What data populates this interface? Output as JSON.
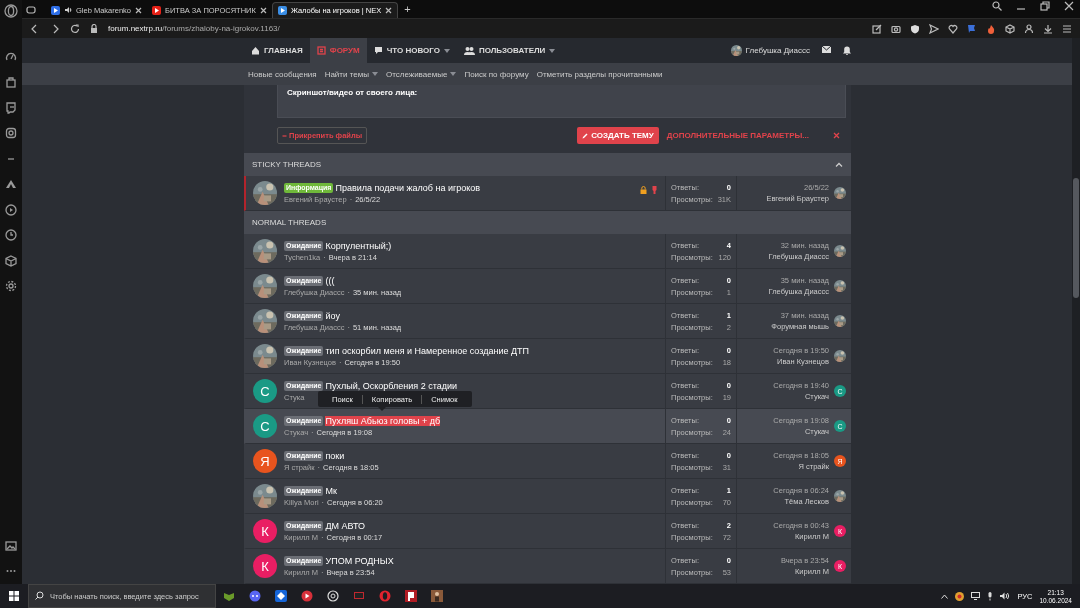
{
  "browser": {
    "tabs": [
      {
        "title": "Gleb Makarenko",
        "selected": false,
        "audio": true
      },
      {
        "title": "БИТВА ЗА ПОРОСЯТНИК",
        "selected": false,
        "audio": false
      },
      {
        "title": "Жалобы на игроков | NEX",
        "selected": true,
        "audio": false
      }
    ],
    "new_tab": "+",
    "url_host": "forum.nextrp.ru",
    "url_path": "/forums/zhaloby-na-igrokov.1163/"
  },
  "forum": {
    "nav": [
      {
        "label": "ГЛАВНАЯ",
        "selected": false,
        "dropdown": false
      },
      {
        "label": "ФОРУМ",
        "selected": true,
        "dropdown": false
      },
      {
        "label": "ЧТО НОВОГО",
        "selected": false,
        "dropdown": true
      },
      {
        "label": "ПОЛЬЗОВАТЕЛИ",
        "selected": false,
        "dropdown": true
      }
    ],
    "user": "Глебушка Диассс",
    "subnav": [
      {
        "label": "Новые сообщения",
        "dropdown": false
      },
      {
        "label": "Найти темы",
        "dropdown": true
      },
      {
        "label": "Отслеживаемые",
        "dropdown": true
      },
      {
        "label": "Поиск по форуму",
        "dropdown": false
      },
      {
        "label": "Отметить разделы прочитанными",
        "dropdown": false
      }
    ],
    "editor_line": "Скриншот/видео от своего лица:",
    "attach_button": "Прикрепить файлы",
    "create_button": "СОЗДАТЬ ТЕМУ",
    "more_options": "ДОПОЛНИТЕЛЬНЫЕ ПАРАМЕТРЫ...",
    "meta_separator": "·",
    "sections": [
      {
        "title": "STICKY THREADS",
        "collapsible": true,
        "threads": [
          {
            "prefix": {
              "text": "Информация",
              "color": "#6fb83a"
            },
            "title": "Правила подачи жалоб на игроков",
            "author": "Евгений Браустер",
            "date": "26/5/22",
            "replies_label": "Ответы:",
            "replies": "0",
            "views_label": "Просмотры:",
            "views": "31K",
            "last_date": "26/5/22",
            "last_user": "Евгений Браустер",
            "locked": true,
            "pinned": true,
            "marked": true,
            "selected": false,
            "title_selected": false
          }
        ]
      },
      {
        "title": "NORMAL THREADS",
        "collapsible": false,
        "threads": [
          {
            "prefix": {
              "text": "Ожидание",
              "color": "#6b6e75"
            },
            "title": "Корпулентный;)",
            "author": "Tychen1ka",
            "date": "Вчера в 21:14",
            "replies_label": "Ответы:",
            "replies": "4",
            "views_label": "Просмотры:",
            "views": "120",
            "last_date": "32 мин. назад",
            "last_user": "Глебушка Диассс",
            "locked": false,
            "pinned": false,
            "marked": false,
            "selected": false,
            "title_selected": false
          },
          {
            "prefix": {
              "text": "Ожидание",
              "color": "#6b6e75"
            },
            "title": "(((",
            "author": "Глебушка Диассс",
            "date": "35 мин. назад",
            "replies_label": "Ответы:",
            "replies": "0",
            "views_label": "Просмотры:",
            "views": "1",
            "last_date": "35 мин. назад",
            "last_user": "Глебушка Диассс",
            "locked": false,
            "pinned": false,
            "marked": false,
            "selected": false,
            "title_selected": false
          },
          {
            "prefix": {
              "text": "Ожидание",
              "color": "#6b6e75"
            },
            "title": "йоу",
            "author": "Глебушка Диассс",
            "date": "51 мин. назад",
            "replies_label": "Ответы:",
            "replies": "1",
            "views_label": "Просмотры:",
            "views": "2",
            "last_date": "37 мин. назад",
            "last_user": "Форумная мышь",
            "locked": false,
            "pinned": false,
            "marked": false,
            "selected": false,
            "title_selected": false
          },
          {
            "prefix": {
              "text": "Ожидание",
              "color": "#6b6e75"
            },
            "title": "тип оскорбил меня и Намеренное создание ДТП",
            "author": "Иван Кузнецов",
            "date": "Сегодня в 19:50",
            "replies_label": "Ответы:",
            "replies": "0",
            "views_label": "Просмотры:",
            "views": "18",
            "last_date": "Сегодня в 19:50",
            "last_user": "Иван Кузнецов",
            "locked": false,
            "pinned": false,
            "marked": false,
            "selected": false,
            "title_selected": false
          },
          {
            "prefix": {
              "text": "Ожидание",
              "color": "#6b6e75"
            },
            "title": "Пухлый, Оскорбления 2 стадии",
            "author": "Стука",
            "replies_label": "Ответы:",
            "replies": "0",
            "views_label": "Просмотры:",
            "views": "19",
            "last_date": "Сегодня в 19:40",
            "last_user": "Стукач",
            "avatar": {
              "kind": "letter",
              "letter": "С",
              "color": "#1a9a85"
            },
            "last_avatar": {
              "kind": "letter",
              "letter": "С",
              "color": "#1a9a85"
            },
            "locked": false,
            "pinned": false,
            "marked": false,
            "selected": false,
            "title_selected": false
          },
          {
            "prefix": {
              "text": "Ожидание",
              "color": "#6b6e75"
            },
            "title": "Пухляш Абьюз головы + дб",
            "author": "Стукач",
            "date": "Сегодня в 19:08",
            "replies_label": "Ответы:",
            "replies": "0",
            "views_label": "Просмотры:",
            "views": "24",
            "last_date": "Сегодня в 19:08",
            "last_user": "Стукач",
            "avatar": {
              "kind": "letter",
              "letter": "С",
              "color": "#1a9a85"
            },
            "last_avatar": {
              "kind": "letter",
              "letter": "С",
              "color": "#1a9a85"
            },
            "locked": false,
            "pinned": false,
            "marked": false,
            "selected": true,
            "title_selected": true
          },
          {
            "prefix": {
              "text": "Ожидание",
              "color": "#6b6e75"
            },
            "title": "поки",
            "author": "Я страйк",
            "date": "Сегодня в 18:05",
            "replies_label": "Ответы:",
            "replies": "0",
            "views_label": "Просмотры:",
            "views": "31",
            "last_date": "Сегодня в 18:05",
            "last_user": "Я страйк",
            "avatar": {
              "kind": "letter",
              "letter": "Я",
              "color": "#e8541e"
            },
            "last_avatar": {
              "kind": "letter",
              "letter": "Я",
              "color": "#e8541e"
            },
            "locked": false,
            "pinned": false,
            "marked": false,
            "selected": false,
            "title_selected": false
          },
          {
            "prefix": {
              "text": "Ожидание",
              "color": "#6b6e75"
            },
            "title": "Мк",
            "author": "Killya Mori",
            "date": "Сегодня в 06:20",
            "replies_label": "Ответы:",
            "replies": "1",
            "views_label": "Просмотры:",
            "views": "70",
            "last_date": "Сегодня в 06:24",
            "last_user": "Тёма Лесков",
            "locked": false,
            "pinned": false,
            "marked": false,
            "selected": false,
            "title_selected": false
          },
          {
            "prefix": {
              "text": "Ожидание",
              "color": "#6b6e75"
            },
            "title": "ДМ АВТО",
            "author": "Кирилл М",
            "date": "Сегодня в 00:17",
            "replies_label": "Ответы:",
            "replies": "2",
            "views_label": "Просмотры:",
            "views": "72",
            "last_date": "Сегодня в 00:43",
            "last_user": "Кирилл М",
            "avatar": {
              "kind": "letter",
              "letter": "К",
              "color": "#e91e63"
            },
            "last_avatar": {
              "kind": "letter",
              "letter": "К",
              "color": "#e91e63"
            },
            "locked": false,
            "pinned": false,
            "marked": false,
            "selected": false,
            "title_selected": false
          },
          {
            "prefix": {
              "text": "Ожидание",
              "color": "#6b6e75"
            },
            "title": "УПОМ РОДНЫХ",
            "author": "Кирилл М",
            "date": "Вчера в 23:54",
            "replies_label": "Ответы:",
            "replies": "0",
            "views_label": "Просмотры:",
            "views": "53",
            "last_date": "Вчера в 23:54",
            "last_user": "Кирилл М",
            "avatar": {
              "kind": "letter",
              "letter": "К",
              "color": "#e91e63"
            },
            "last_avatar": {
              "kind": "letter",
              "letter": "К",
              "color": "#e91e63"
            },
            "locked": false,
            "pinned": false,
            "marked": false,
            "selected": false,
            "title_selected": false
          }
        ]
      }
    ]
  },
  "context_menu": {
    "items": [
      "Поиск",
      "Копировать",
      "Снимок"
    ]
  },
  "taskbar": {
    "search_placeholder": "Чтобы начать поиск, введите здесь запрос",
    "language": "РУС",
    "time": "21:13",
    "date": "10.06.2024"
  }
}
